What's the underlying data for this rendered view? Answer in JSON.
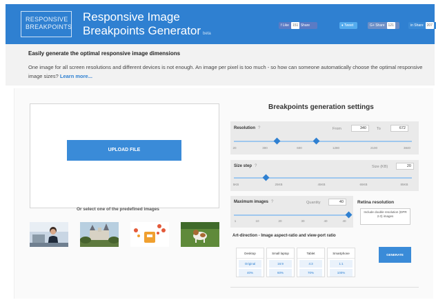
{
  "header": {
    "logo_line1": "RESPONSIVE",
    "logo_line2": "BREAKPOINTS",
    "title_line1": "Responsive Image",
    "title_line2": "Breakpoints Generator",
    "version": "beta",
    "social": {
      "facebook": "Like",
      "facebook_share": "Share",
      "facebook_count": "151",
      "twitter": "Tweet",
      "google": "Share",
      "google_count": "121",
      "linkedin": "Share",
      "linkedin_count": "207"
    }
  },
  "intro": {
    "heading": "Easily generate the optimal responsive image dimensions",
    "text": "One image for all screen resolutions and different devices is not enough. An image per pixel is too much - so how can someone automatically choose the optimal responsive image sizes?",
    "link": "Learn more..."
  },
  "upload": {
    "button": "UPLOAD FILE",
    "predefined_label": "Or select one of the predefined images"
  },
  "settings": {
    "title": "Breakpoints generation settings",
    "resolution": {
      "label": "Resolution",
      "from_label": "From",
      "from_value": "340",
      "to_label": "To",
      "to_value": "672",
      "ticks": [
        "20",
        "300",
        "600",
        "1280",
        "2100",
        "3840"
      ]
    },
    "size_step": {
      "label": "Size step",
      "size_label": "Size (KB)",
      "value": "20",
      "ticks": [
        "5KB",
        "25KB",
        "45KB",
        "65KB",
        "85KB"
      ]
    },
    "max_images": {
      "label": "Maximum images",
      "quantity_label": "Quantity",
      "value": "40",
      "ticks": [
        "1",
        "10",
        "20",
        "30",
        "40",
        "40"
      ]
    },
    "retina": {
      "label": "Retina resolution",
      "option": "Include double resolution (DPR 2.0) images"
    },
    "art_direction": {
      "label": "Art-direction - Image aspect-ratio and view-port ratio",
      "ratios": [
        {
          "name": "Desktop",
          "aspect": "Original",
          "viewport": "40%"
        },
        {
          "name": "Small laptop",
          "aspect": "16:9",
          "viewport": "60%"
        },
        {
          "name": "Tablet",
          "aspect": "4:3",
          "viewport": "70%"
        },
        {
          "name": "Smartphone",
          "aspect": "1:1",
          "viewport": "100%"
        }
      ]
    },
    "generate": "GENERATE"
  },
  "colors": {
    "primary": "#2f80d1",
    "button": "#3a8bd8"
  }
}
